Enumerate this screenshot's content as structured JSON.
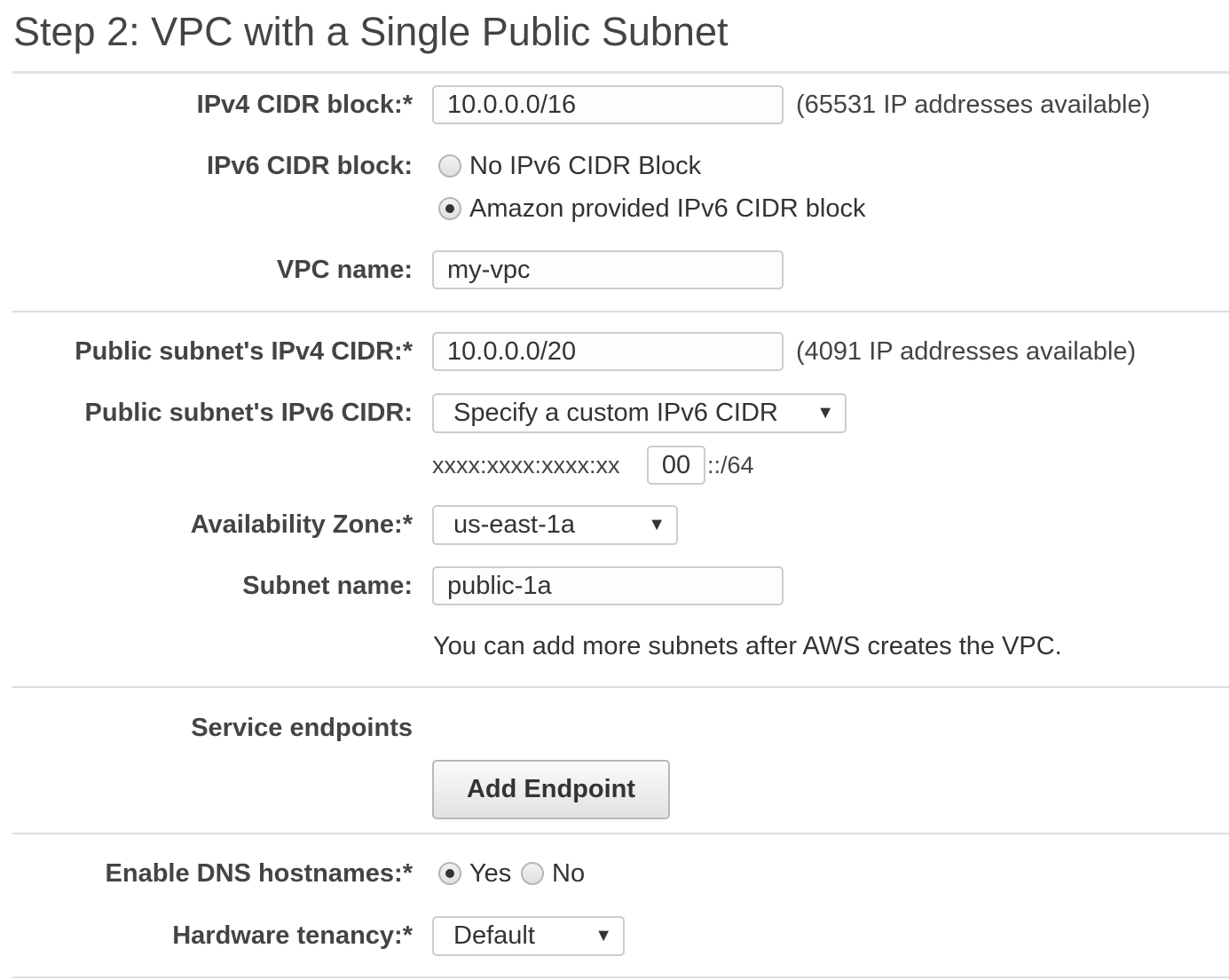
{
  "title": "Step 2: VPC with a Single Public Subnet",
  "ipv4_cidr": {
    "label": "IPv4 CIDR block:*",
    "value": "10.0.0.0/16",
    "hint": "(65531 IP addresses available)"
  },
  "ipv6_cidr": {
    "label": "IPv6 CIDR block:",
    "options": [
      {
        "label": "No IPv6 CIDR Block",
        "checked": false
      },
      {
        "label": "Amazon provided IPv6 CIDR block",
        "checked": true
      }
    ]
  },
  "vpc_name": {
    "label": "VPC name:",
    "value": "my-vpc"
  },
  "public_subnet_ipv4": {
    "label": "Public subnet's IPv4 CIDR:*",
    "value": "10.0.0.0/20",
    "hint": "(4091 IP addresses available)"
  },
  "public_subnet_ipv6": {
    "label": "Public subnet's IPv6 CIDR:",
    "selected": "Specify a custom IPv6 CIDR",
    "prefix": "xxxx:xxxx:xxxx:xx",
    "custom_value": "00",
    "suffix": "::/64"
  },
  "availability_zone": {
    "label": "Availability Zone:*",
    "selected": "us-east-1a"
  },
  "subnet_name": {
    "label": "Subnet name:",
    "value": "public-1a",
    "note": "You can add more subnets after AWS creates the VPC."
  },
  "service_endpoints": {
    "label": "Service endpoints",
    "button_label": "Add Endpoint"
  },
  "dns_hostnames": {
    "label": "Enable DNS hostnames:*",
    "options": [
      {
        "label": "Yes",
        "checked": true
      },
      {
        "label": "No",
        "checked": false
      }
    ]
  },
  "hardware_tenancy": {
    "label": "Hardware tenancy:*",
    "selected": "Default"
  },
  "icons": {
    "dropdown_arrow": "▼"
  }
}
